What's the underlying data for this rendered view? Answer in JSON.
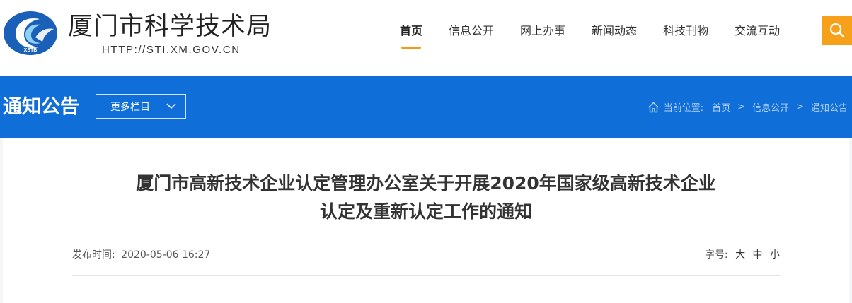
{
  "header": {
    "logo_text_cn": "厦门市科学技术局",
    "logo_url": "HTTP://STI.XM.GOV.CN",
    "logo_badge": "XSTB",
    "nav": [
      {
        "label": "首页",
        "active": true
      },
      {
        "label": "信息公开",
        "active": false
      },
      {
        "label": "网上办事",
        "active": false
      },
      {
        "label": "新闻动态",
        "active": false
      },
      {
        "label": "科技刊物",
        "active": false
      },
      {
        "label": "交流互动",
        "active": false
      }
    ],
    "search_icon": "search-icon",
    "accent_color": "#f7a01a"
  },
  "banner": {
    "section_title": "通知公告",
    "more_button": "更多栏目",
    "breadcrumb": {
      "prefix": "当前位置:",
      "items": [
        "首页",
        "信息公开",
        "通知公告"
      ],
      "separator": ">"
    },
    "bg_color": "#0f6ed8"
  },
  "article": {
    "title_line1": "厦门市高新技术企业认定管理办公室关于开展2020年国家级高新技术企业",
    "title_line2": "认定及重新认定工作的通知",
    "publish_label": "发布时间:",
    "publish_time": "2020-05-06 16:27",
    "font_size_label": "字号:",
    "font_sizes": [
      "大",
      "中",
      "小"
    ]
  }
}
